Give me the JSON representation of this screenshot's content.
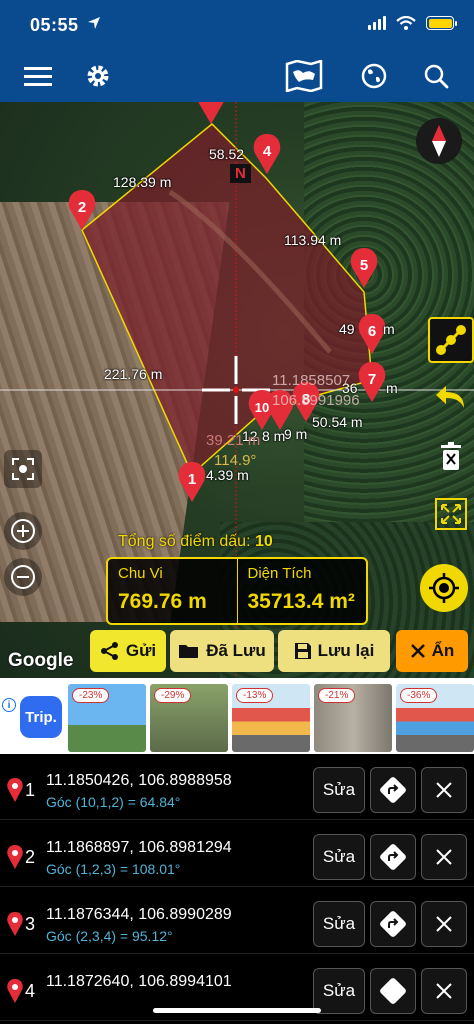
{
  "status": {
    "time": "05:55"
  },
  "map": {
    "distances": [
      "58.52",
      "128.39 m",
      "113.94 m",
      "221.76 m",
      "49",
      "m",
      "36",
      "m",
      "50.54 m",
      "9 m",
      "12",
      "8 m",
      "39.21 m",
      "4.39 m"
    ],
    "north": "N",
    "coord_overlay_1": "11.1858507",
    "coord_overlay_2": "106.8991996",
    "angle_overlay": "114.9°",
    "markers": [
      "1",
      "2",
      "4",
      "5",
      "6",
      "7",
      "8",
      "10"
    ],
    "point_count_label": "Tổng số điểm dấu:",
    "point_count": "10",
    "perimeter_label": "Chu Vi",
    "perimeter_value": "769.76 m",
    "area_label": "Diện Tích",
    "area_value": "35713.4 m²",
    "google": "Google"
  },
  "actions": {
    "send": "Gửi",
    "saved": "Đã Lưu",
    "save": "Lưu lại",
    "hide": "Ẩn"
  },
  "ad": {
    "brand": "Trip.",
    "info": "i",
    "discounts": [
      "-23%",
      "-29%",
      "-13%",
      "-21%",
      "-36%"
    ]
  },
  "points": [
    {
      "num": "1",
      "coord": "11.1850426, 106.8988958",
      "angle": "Góc (10,1,2) = 64.84°"
    },
    {
      "num": "2",
      "coord": "11.1868897, 106.8981294",
      "angle": "Góc (1,2,3) = 108.01°"
    },
    {
      "num": "3",
      "coord": "11.1876344, 106.8990289",
      "angle": "Góc (2,3,4) = 95.12°"
    },
    {
      "num": "4",
      "coord": "11.1872640, 106.8994101",
      "angle": ""
    }
  ],
  "row_labels": {
    "edit": "Sửa"
  },
  "colors": {
    "nav": "#0a4a8f",
    "accent": "#f1d800",
    "polygon_fill": "#7a1f2a",
    "angle_text": "#4fb3d9"
  }
}
